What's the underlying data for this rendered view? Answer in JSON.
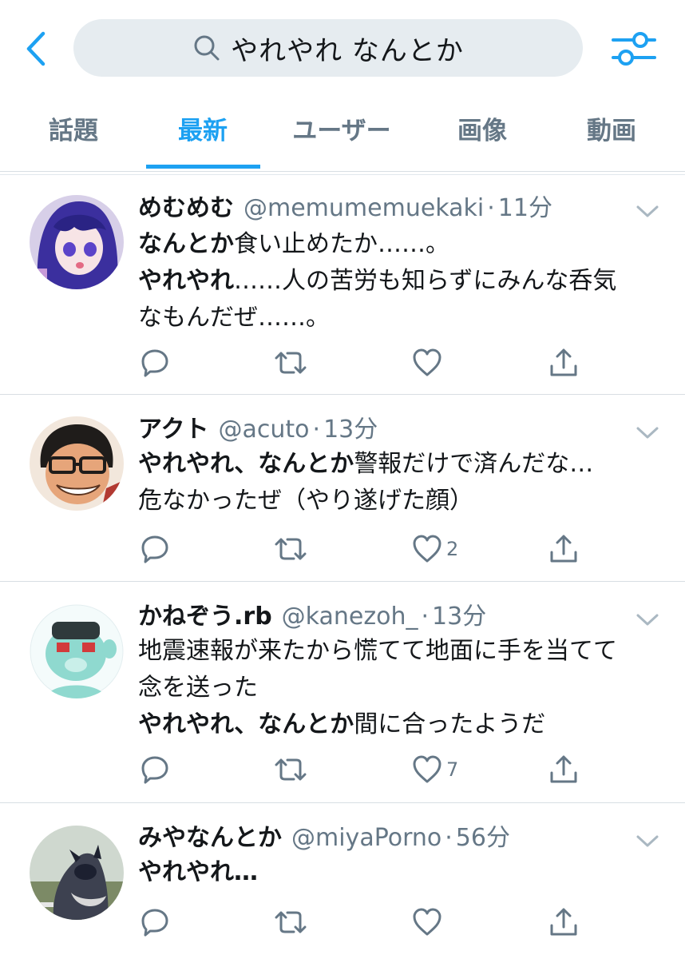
{
  "search": {
    "query": "やれやれ なんとか"
  },
  "tabs": [
    {
      "label": "話題"
    },
    {
      "label": "最新",
      "active": true
    },
    {
      "label": "ユーザー"
    },
    {
      "label": "画像"
    },
    {
      "label": "動画"
    }
  ],
  "colors": {
    "accent": "#1da1f2",
    "muted": "#657786",
    "text": "#14171a",
    "search_bg": "#e6ecf0"
  },
  "tweets": [
    {
      "name": "めむめむ",
      "handle": "@memumemuekaki",
      "sep": "·",
      "time": "11分",
      "lines": [
        {
          "b": "なんとか",
          "t": "食い止めたか……。"
        },
        {
          "b": "やれやれ",
          "t": "……人の苦労も知らずにみんな呑気"
        },
        {
          "b": "",
          "t": "なもんだぜ……。"
        }
      ],
      "likes": ""
    },
    {
      "name": "アクト",
      "handle": "@acuto",
      "sep": "·",
      "time": "13分",
      "lines": [
        {
          "b": "やれやれ、なんとか",
          "t": "警報だけで済んだな…"
        },
        {
          "b": "",
          "t": "危なかったぜ（やり遂げた顔）"
        }
      ],
      "likes": "2"
    },
    {
      "name": "かねぞう.rb",
      "handle": "@kanezoh_",
      "sep": "·",
      "time": "13分",
      "lines": [
        {
          "b": "",
          "t": "地震速報が来たから慌てて地面に手を当てて"
        },
        {
          "b": "",
          "t": "念を送った"
        },
        {
          "b": "やれやれ、なんとか",
          "t": "間に合ったようだ"
        }
      ],
      "likes": "7"
    },
    {
      "name": "みやなんとか",
      "handle": "@miyaPorno",
      "sep": "·",
      "time": "56分",
      "lines": [
        {
          "b": "やれやれ",
          "t": "…"
        }
      ],
      "likes": ""
    }
  ]
}
